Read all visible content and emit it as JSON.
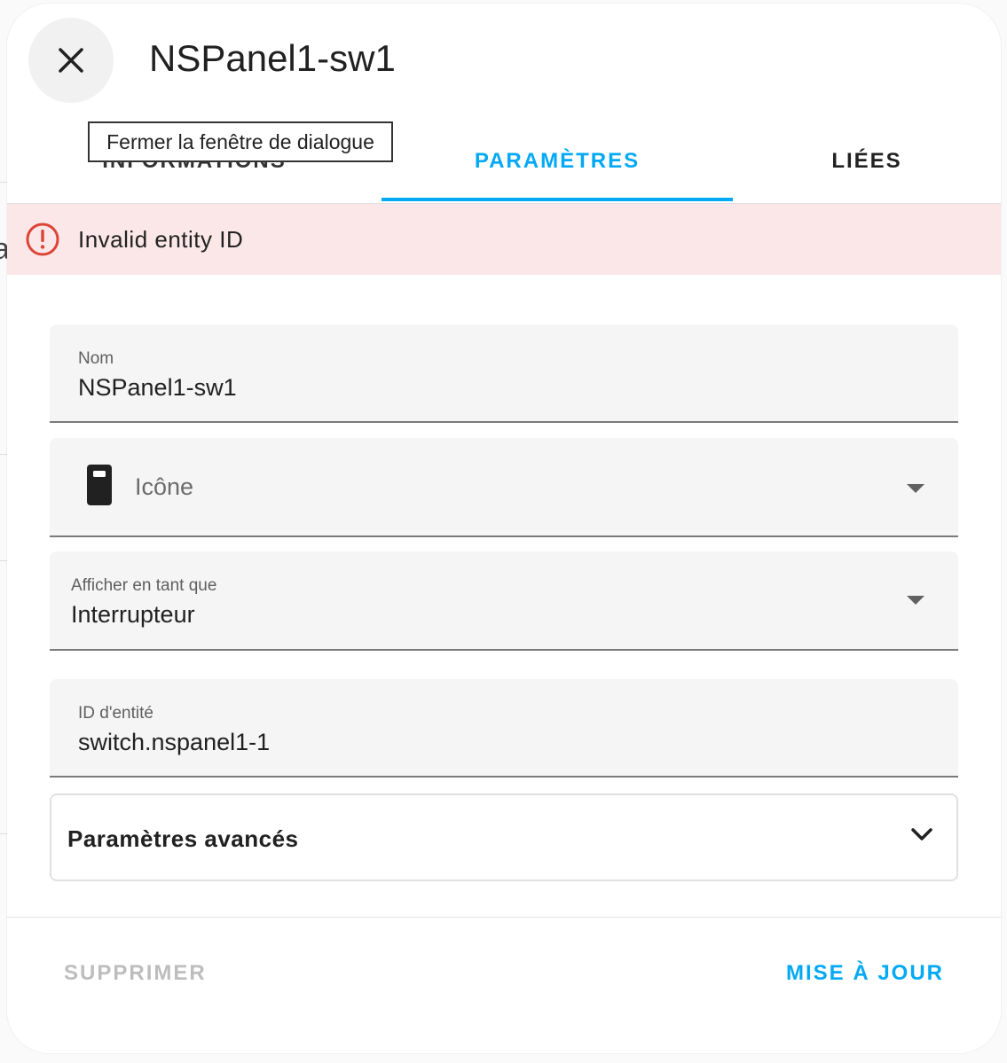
{
  "dialog": {
    "title": "NSPanel1-sw1",
    "close_tooltip": "Fermer la fenêtre de dialogue"
  },
  "tabs": [
    {
      "label": "INFORMATIONS",
      "active": false
    },
    {
      "label": "PARAMÈTRES",
      "active": true
    },
    {
      "label": "LIÉES",
      "active": false
    }
  ],
  "alert": {
    "message": "Invalid entity ID"
  },
  "form": {
    "name": {
      "label": "Nom",
      "value": "NSPanel1-sw1"
    },
    "icon": {
      "placeholder": "Icône",
      "icon_name": "light-switch-icon"
    },
    "display_as": {
      "label": "Afficher en tant que",
      "value": "Interrupteur"
    },
    "entity_id": {
      "label": "ID d'entité",
      "value": "switch.nspanel1-1"
    },
    "advanced": {
      "label": "Paramètres avancés"
    }
  },
  "footer": {
    "delete_label": "SUPPRIMER",
    "update_label": "MISE À JOUR"
  },
  "colors": {
    "accent": "#03a9f4",
    "error": "#db4437",
    "error_bg": "#fbe7e7"
  }
}
